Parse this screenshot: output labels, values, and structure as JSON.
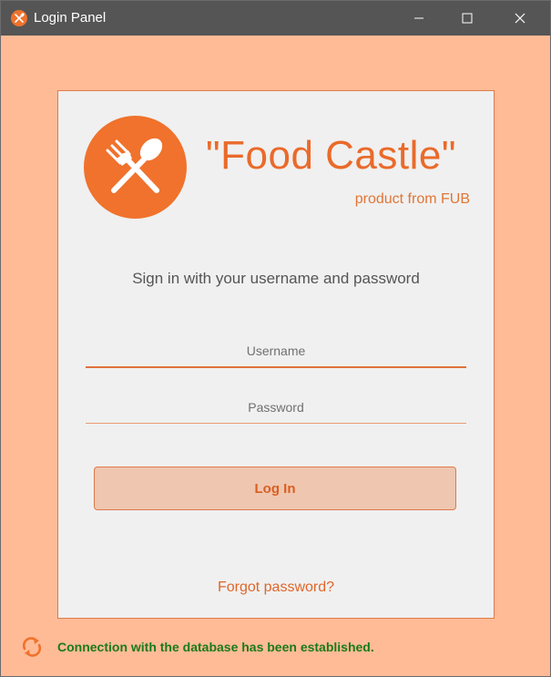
{
  "window": {
    "title": "Login Panel",
    "app_icon": "fork-spoon-icon",
    "controls": [
      "minimize-icon",
      "maximize-icon",
      "close-icon"
    ]
  },
  "panel": {
    "logo_icon": "crossed-fork-spoon-icon",
    "brand_title": "\"Food Castle\"",
    "brand_subtitle": "product from FUB",
    "prompt": "Sign in with your username and password",
    "username_placeholder": "Username",
    "username_value": "",
    "password_placeholder": "Password",
    "password_value": "",
    "login_label": "Log In",
    "forgot_label": "Forgot password?"
  },
  "status": {
    "icon": "sync-icon",
    "message": "Connection with the database has been established."
  },
  "colors": {
    "window_background": "#ffbb96",
    "titlebar": "#555555",
    "accent": "#f0722c",
    "panel_background": "#f0f0f0",
    "status_text": "#1a7a1a"
  }
}
